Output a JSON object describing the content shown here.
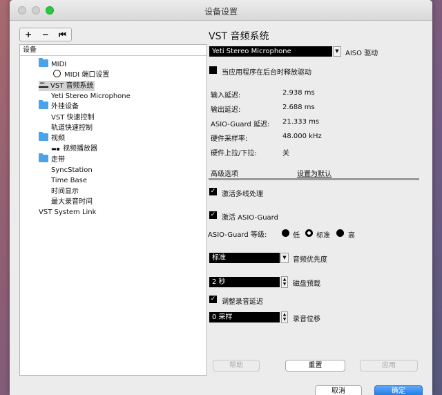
{
  "window": {
    "title": "设备设置"
  },
  "tree": {
    "toolbar": {
      "add": "+",
      "remove": "−",
      "reset": "⏮"
    },
    "header": "设备",
    "items": [
      {
        "label": "MIDI",
        "icon": "folder-icon"
      },
      {
        "label": "MIDI 端口设置",
        "icon": "midi-port-icon"
      },
      {
        "label": "VST 音频系统",
        "icon": "vst-audio-icon"
      },
      {
        "label": "Yeti Stereo Microphone",
        "icon": ""
      },
      {
        "label": "外挂设备",
        "icon": "folder-icon"
      },
      {
        "label": "VST 快速控制",
        "icon": ""
      },
      {
        "label": "轨道快速控制",
        "icon": ""
      },
      {
        "label": "视频",
        "icon": "folder-icon"
      },
      {
        "label": "视频播放器",
        "icon": "video-player-icon"
      },
      {
        "label": "走带",
        "icon": "folder-icon"
      },
      {
        "label": "SyncStation",
        "icon": ""
      },
      {
        "label": "Time Base",
        "icon": ""
      },
      {
        "label": "时间显示",
        "icon": ""
      },
      {
        "label": "最大录音时间",
        "icon": ""
      },
      {
        "label": "VST System Link",
        "icon": ""
      }
    ]
  },
  "panel": {
    "title": "VST 音频系统",
    "driver": {
      "value": "Yeti Stereo Microphone",
      "label": "AISO 驱动"
    },
    "release_driver": {
      "label": "当应用程序在后台时释放驱动",
      "checked": true
    },
    "info": [
      {
        "label": "输入延迟:",
        "value": "2.938 ms"
      },
      {
        "label": "输出延迟:",
        "value": "2.688 ms"
      },
      {
        "label": "ASIO-Guard 延迟:",
        "value": "21.333 ms"
      },
      {
        "label": "硬件采样率:",
        "value": "48.000 kHz"
      },
      {
        "label": "硬件上拉/下拉:",
        "value": "关"
      }
    ],
    "advanced_label": "高级选项",
    "set_default_label": "设置为默认",
    "multithread": {
      "label": "激活多线处理",
      "checked": true
    },
    "asio_guard": {
      "label": "激活 ASIO-Guard",
      "checked": true
    },
    "asio_level": {
      "label": "ASIO-Guard 等级:",
      "options": [
        "低",
        "标准",
        "高"
      ],
      "selected": "标准"
    },
    "audio_priority": {
      "value": "标准",
      "label": "音频优先度"
    },
    "disk_preload": {
      "value": "2 秒",
      "label": "磁盘预载"
    },
    "adjust_latency": {
      "label": "调整录音延迟",
      "checked": true
    },
    "record_shift": {
      "value": "0 采样",
      "label": "录音位移"
    },
    "buttons": {
      "help": "帮助",
      "reset": "重置",
      "apply": "应用"
    }
  },
  "footer": {
    "cancel": "取消",
    "ok": "确定"
  },
  "colors": {
    "accent": "#1a76e8",
    "folder": "#4aa3e8",
    "zoom": "#2ac940"
  }
}
